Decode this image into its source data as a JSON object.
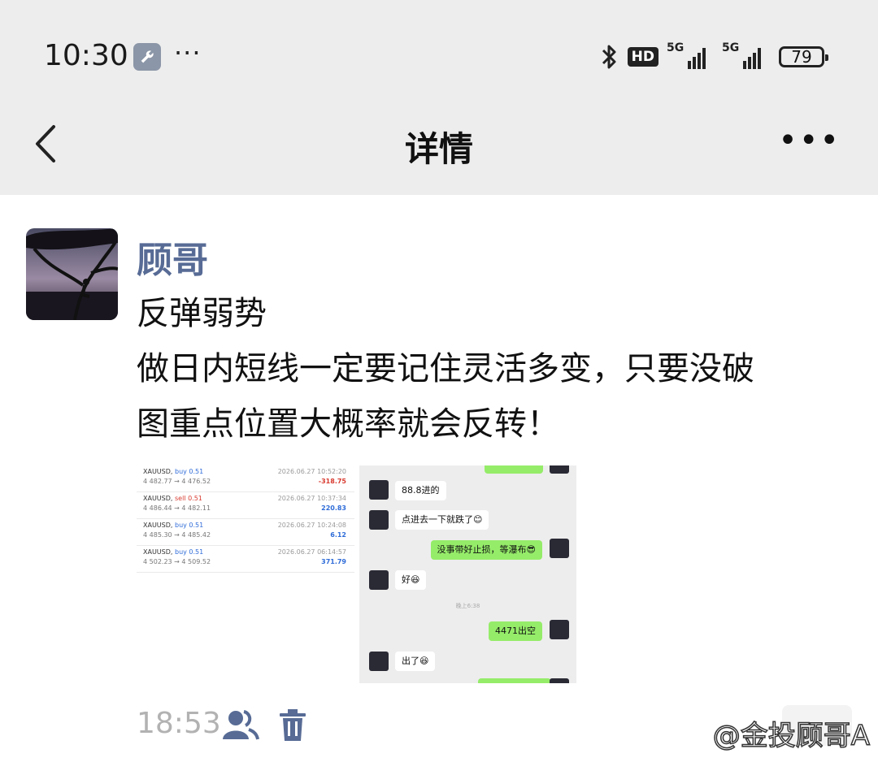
{
  "status_bar": {
    "time": "10:30",
    "more": "···",
    "hd_label": "HD",
    "signal1_label": "5G",
    "signal2_label": "5G",
    "battery": "79"
  },
  "nav": {
    "title": "详情",
    "more": "•••"
  },
  "post": {
    "author": "顾哥",
    "lines": [
      "反弹弱势",
      "做日内短线一定要记住灵活多变，只要没破",
      "图重点位置大概率就会反转！"
    ],
    "time": "18:53",
    "watermark": "@金投顾哥A"
  },
  "trades": [
    {
      "symbol": "XAUUSD,",
      "side": "buy 0.51",
      "side_type": "buy",
      "prices": "4 482.77 → 4 476.52",
      "datetime": "2026.06.27 10:52:20",
      "pl": "-318.75",
      "pl_type": "neg"
    },
    {
      "symbol": "XAUUSD,",
      "side": "sell 0.51",
      "side_type": "sell",
      "prices": "4 486.44 → 4 482.11",
      "datetime": "2026.06.27 10:37:34",
      "pl": "220.83",
      "pl_type": "pos"
    },
    {
      "symbol": "XAUUSD,",
      "side": "buy 0.51",
      "side_type": "buy",
      "prices": "4 485.30 → 4 485.42",
      "datetime": "2026.06.27 10:24:08",
      "pl": "6.12",
      "pl_type": "pos"
    },
    {
      "symbol": "XAUUSD,",
      "side": "buy 0.51",
      "side_type": "buy",
      "prices": "4 502.23 → 4 509.52",
      "datetime": "2026.06.27 06:14:57",
      "pl": "371.79",
      "pl_type": "pos"
    }
  ],
  "chat": {
    "messages": [
      {
        "text": "88.8进的"
      },
      {
        "text": "点进去一下就跌了😊"
      },
      {
        "text": "没事带好止损，等瀑布😎"
      },
      {
        "text": "好😆"
      },
      {
        "text": "4471出空"
      },
      {
        "text": "出了😆"
      }
    ],
    "time_sep": "晚上6:38"
  }
}
